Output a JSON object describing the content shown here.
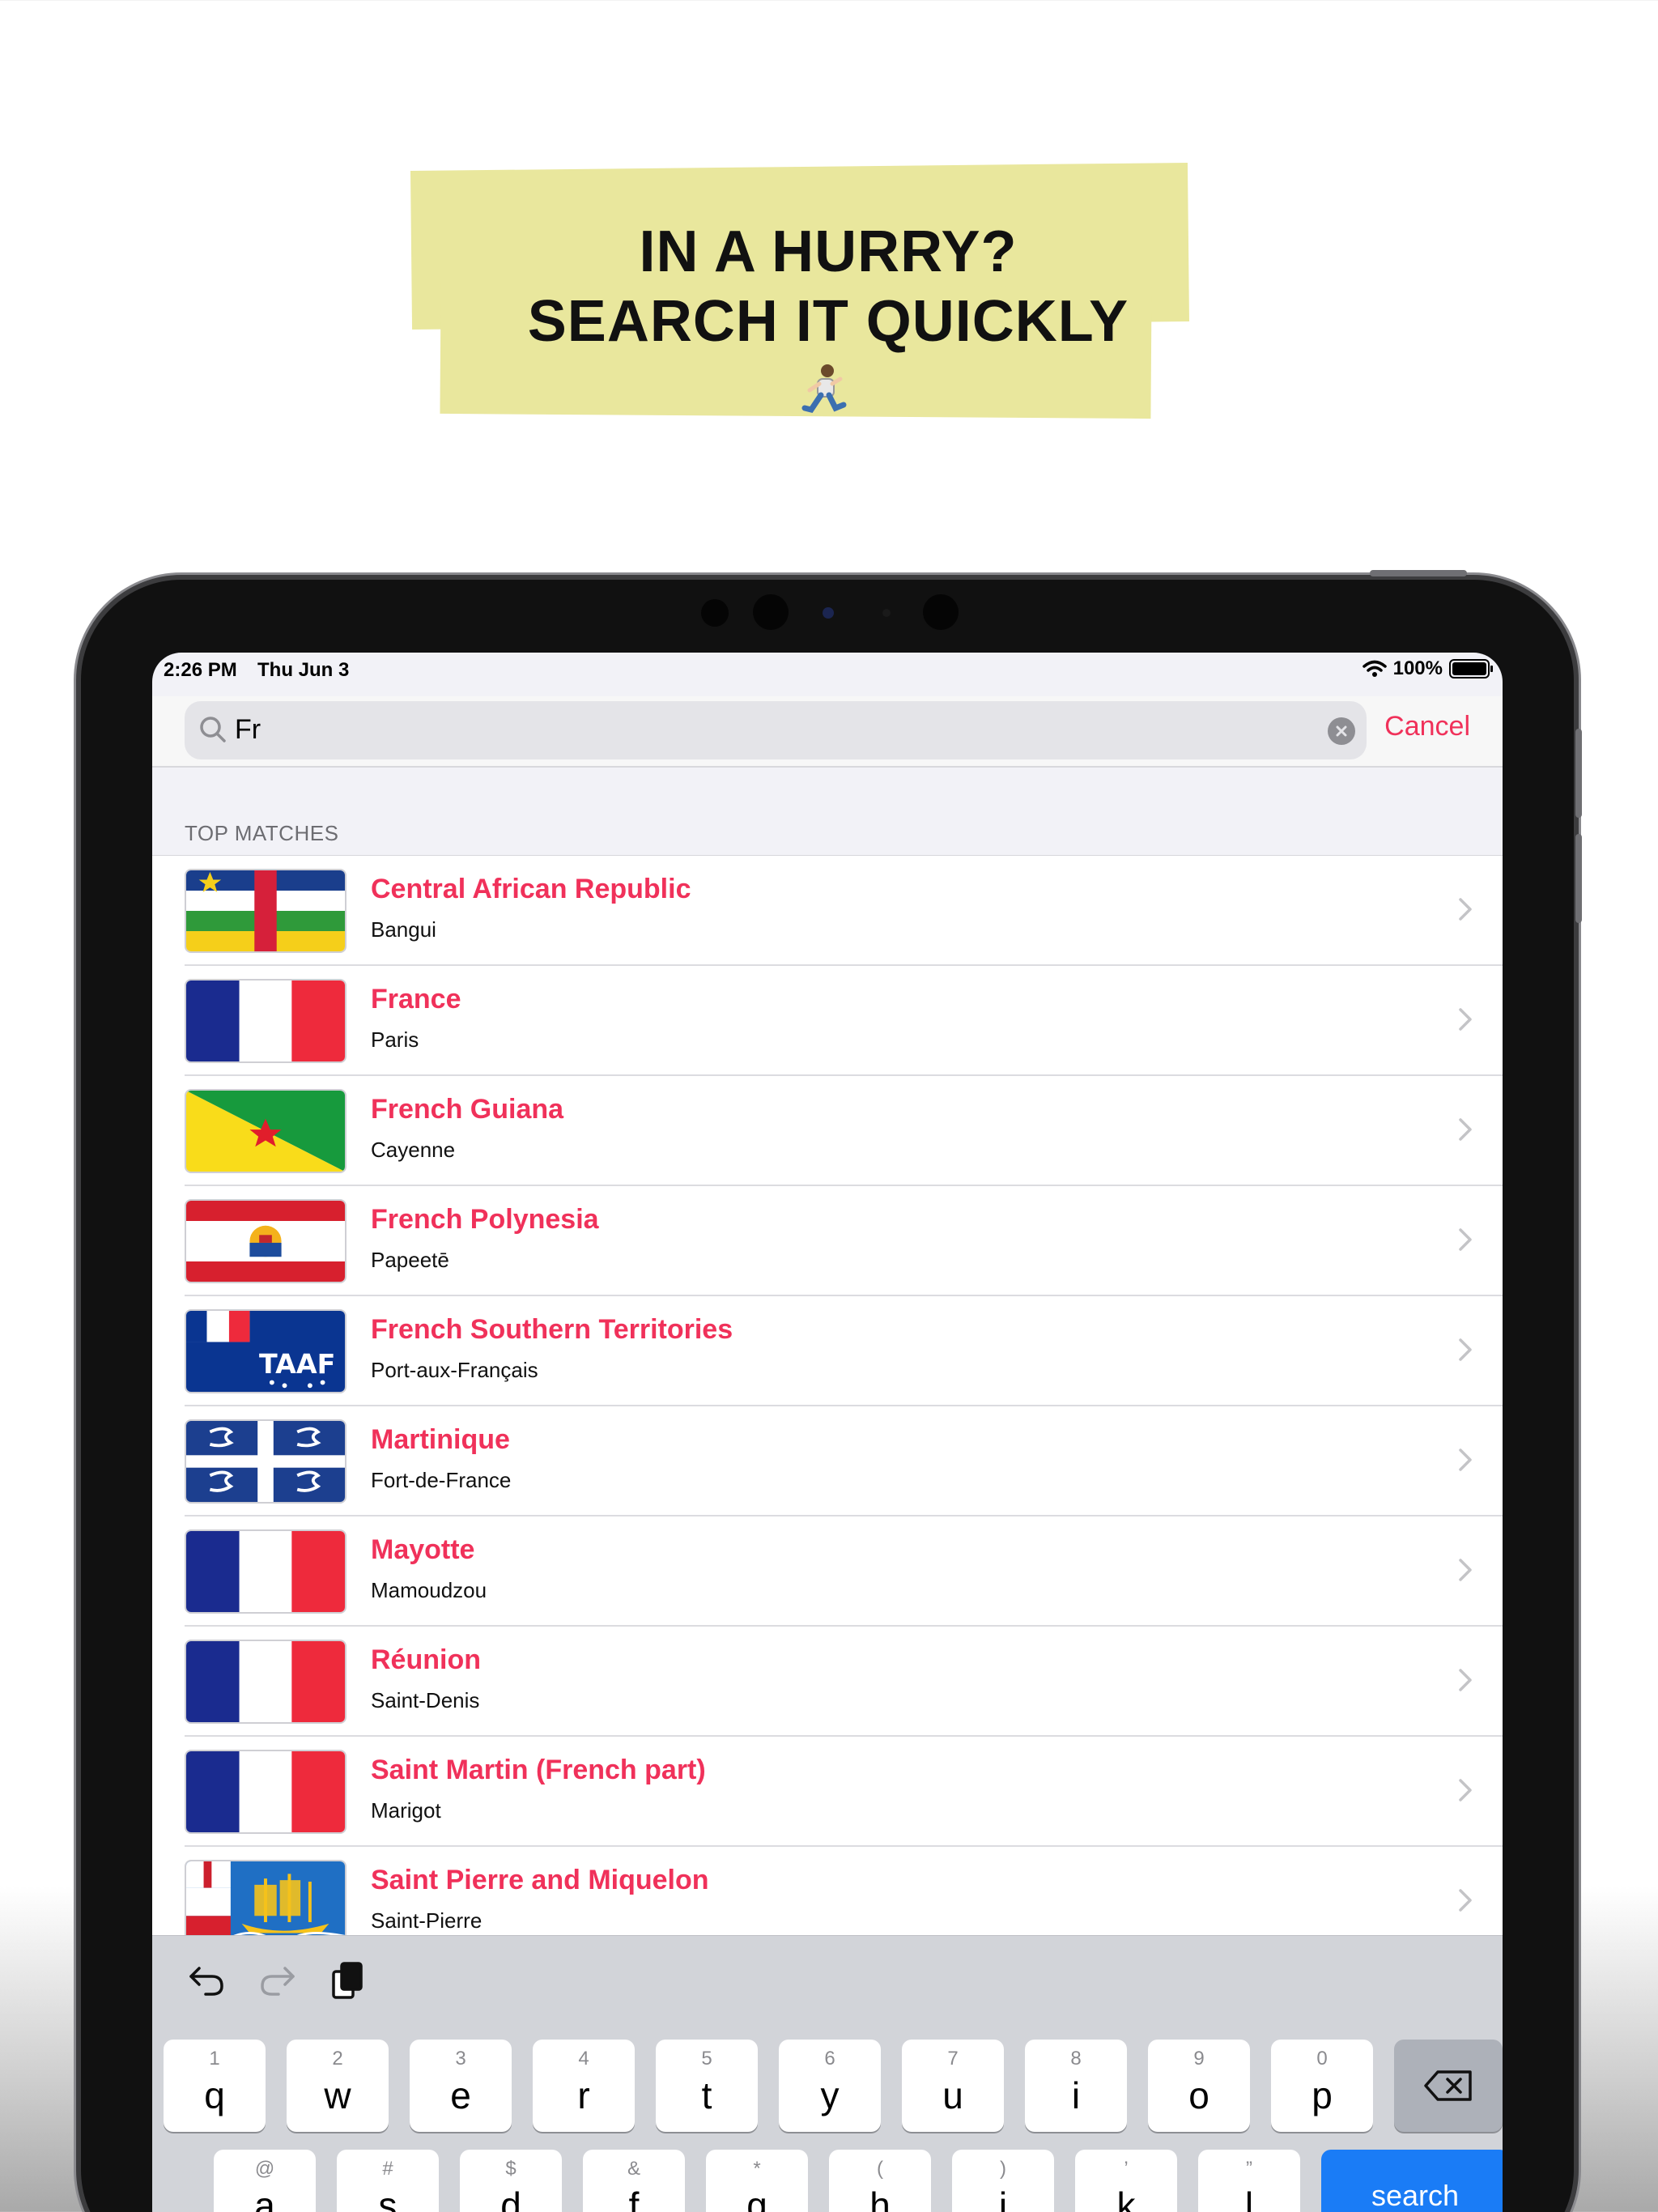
{
  "headline": {
    "line1": "IN A HURRY?",
    "line2": "SEARCH IT QUICKLY"
  },
  "status": {
    "time": "2:26 PM",
    "date": "Thu Jun 3",
    "battery": "100%"
  },
  "search": {
    "value": "Fr",
    "cancel_label": "Cancel"
  },
  "section_header": "TOP MATCHES",
  "results": [
    {
      "name": "Central African Republic",
      "capital": "Bangui"
    },
    {
      "name": "France",
      "capital": "Paris"
    },
    {
      "name": "French Guiana",
      "capital": "Cayenne"
    },
    {
      "name": "French Polynesia",
      "capital": "Papeetē"
    },
    {
      "name": "French Southern Territories",
      "capital": "Port-aux-Français"
    },
    {
      "name": "Martinique",
      "capital": "Fort-de-France"
    },
    {
      "name": "Mayotte",
      "capital": "Mamoudzou"
    },
    {
      "name": "Réunion",
      "capital": "Saint-Denis"
    },
    {
      "name": "Saint Martin (French part)",
      "capital": "Marigot"
    },
    {
      "name": "Saint Pierre and Miquelon",
      "capital": "Saint-Pierre"
    }
  ],
  "keyboard": {
    "row1": [
      {
        "alt": "1",
        "key": "q"
      },
      {
        "alt": "2",
        "key": "w"
      },
      {
        "alt": "3",
        "key": "e"
      },
      {
        "alt": "4",
        "key": "r"
      },
      {
        "alt": "5",
        "key": "t"
      },
      {
        "alt": "6",
        "key": "y"
      },
      {
        "alt": "7",
        "key": "u"
      },
      {
        "alt": "8",
        "key": "i"
      },
      {
        "alt": "9",
        "key": "o"
      },
      {
        "alt": "0",
        "key": "p"
      }
    ],
    "row2": [
      {
        "alt": "@",
        "key": "a"
      },
      {
        "alt": "#",
        "key": "s"
      },
      {
        "alt": "$",
        "key": "d"
      },
      {
        "alt": "&",
        "key": "f"
      },
      {
        "alt": "*",
        "key": "g"
      },
      {
        "alt": "(",
        "key": "h"
      },
      {
        "alt": ")",
        "key": "j"
      },
      {
        "alt": "’",
        "key": "k"
      },
      {
        "alt": "”",
        "key": "l"
      }
    ],
    "search_label": "search"
  },
  "colors": {
    "accent": "#f0315a",
    "tape": "#e9e79d",
    "keyboard_search": "#1a7cf6"
  }
}
